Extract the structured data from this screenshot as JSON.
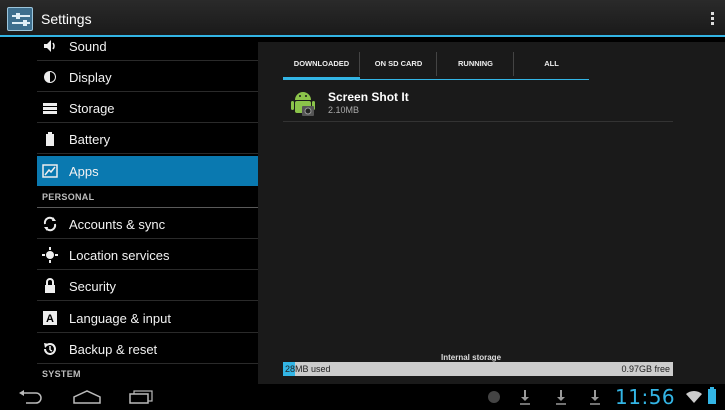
{
  "actionbar": {
    "title": "Settings"
  },
  "sidebar": {
    "items": [
      {
        "label": "Sound",
        "icon": "speaker-icon"
      },
      {
        "label": "Display",
        "icon": "brightness-icon"
      },
      {
        "label": "Storage",
        "icon": "storage-icon"
      },
      {
        "label": "Battery",
        "icon": "battery-icon"
      },
      {
        "label": "Apps",
        "icon": "apps-icon",
        "selected": true
      }
    ],
    "personal_header": "PERSONAL",
    "personal_items": [
      {
        "label": "Accounts & sync",
        "icon": "sync-icon"
      },
      {
        "label": "Location services",
        "icon": "location-icon"
      },
      {
        "label": "Security",
        "icon": "lock-icon"
      },
      {
        "label": "Language & input",
        "icon": "keyboard-icon"
      },
      {
        "label": "Backup & reset",
        "icon": "backup-icon"
      }
    ],
    "system_header": "SYSTEM"
  },
  "main": {
    "tabs": [
      "DOWNLOADED",
      "ON SD CARD",
      "RUNNING",
      "ALL"
    ],
    "active_tab": 0,
    "apps": [
      {
        "name": "Screen Shot It",
        "size": "2.10MB",
        "icon": "android-icon"
      }
    ],
    "storage": {
      "label": "Internal storage",
      "used": "28MB used",
      "free": "0.97GB free",
      "used_fraction": 0.03
    }
  },
  "navbar": {
    "buttons": [
      "back-icon",
      "home-icon",
      "recent-apps-icon"
    ],
    "status_icons": [
      "notification-icon",
      "download-icon",
      "download-icon",
      "download-icon",
      "wifi-icon",
      "battery-icon"
    ],
    "time": "11:56"
  },
  "colors": {
    "accent": "#33b5e5",
    "selected": "#0a79b0",
    "panel": "#1a1a1a"
  }
}
